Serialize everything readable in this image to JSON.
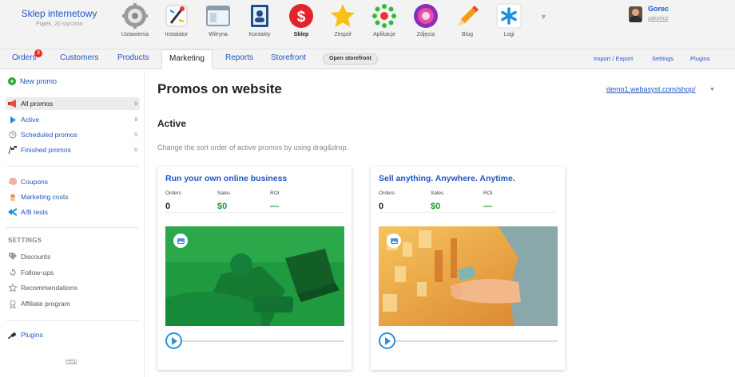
{
  "brand": {
    "name": "Sklep internetowy",
    "date": "Piątek, 20 stycznia"
  },
  "apps": [
    {
      "label": "Ustawienia",
      "icon": "gear-icon"
    },
    {
      "label": "Instalator",
      "icon": "installer-icon"
    },
    {
      "label": "Witryna",
      "icon": "site-icon"
    },
    {
      "label": "Kontakty",
      "icon": "contacts-icon"
    },
    {
      "label": "Sklep",
      "icon": "shop-icon",
      "active": true
    },
    {
      "label": "Zespół",
      "icon": "team-icon"
    },
    {
      "label": "Aplikacje",
      "icon": "apps-icon"
    },
    {
      "label": "Zdjęcia",
      "icon": "photos-icon"
    },
    {
      "label": "Blog",
      "icon": "blog-icon"
    },
    {
      "label": "Logi",
      "icon": "logs-icon"
    }
  ],
  "user": {
    "name": "Gorec",
    "logout": "zakończ"
  },
  "tabs": {
    "orders": "Orders",
    "orders_badge": "3",
    "customers": "Customers",
    "products": "Products",
    "marketing": "Marketing",
    "reports": "Reports",
    "storefront": "Storefront",
    "open_storefront": "Open storefront",
    "import_export": "Import / Export",
    "settings": "Settings",
    "plugins": "Plugins"
  },
  "sidebar": {
    "new_promo": "New promo",
    "promos": [
      {
        "label": "All promos",
        "count": "9",
        "icon": "megaphone-icon"
      },
      {
        "label": "Active",
        "count": "9",
        "icon": "play-icon"
      },
      {
        "label": "Scheduled promos",
        "count": "0",
        "icon": "clock-icon"
      },
      {
        "label": "Finished promos",
        "count": "0",
        "icon": "flag-icon"
      }
    ],
    "tools": [
      {
        "label": "Coupons",
        "icon": "coupon-icon"
      },
      {
        "label": "Marketing costs",
        "icon": "money-icon"
      },
      {
        "label": "A/B tests",
        "icon": "split-icon"
      }
    ],
    "settings_heading": "SETTINGS",
    "settings": [
      {
        "label": "Discounts",
        "icon": "tag-icon"
      },
      {
        "label": "Follow-ups",
        "icon": "followup-icon"
      },
      {
        "label": "Recommendations",
        "icon": "star-icon"
      },
      {
        "label": "Affiliate program",
        "icon": "ribbon-icon"
      }
    ],
    "plugins": "Plugins",
    "help": "Help"
  },
  "main": {
    "title": "Promos on website",
    "storefront": "demo1.webasyst.com/shop/",
    "section": "Active",
    "hint": "Change the sort order of active promos by using drag&drop."
  },
  "metric_labels": {
    "orders": "Orders",
    "sales": "Sales",
    "roi": "ROI"
  },
  "promos": [
    {
      "title": "Run your own online business",
      "orders": "0",
      "sales": "$0",
      "roi": "—"
    },
    {
      "title": "Sell anything. Anywhere. Anytime.",
      "orders": "0",
      "sales": "$0",
      "roi": "—"
    }
  ],
  "colors": {
    "link": "#2256c4",
    "sales_green": "#1d9b2f",
    "badge_red": "#e82a2a",
    "promo1_banner": "#1f9a3f",
    "promo2_banner": "#e8a63a"
  }
}
